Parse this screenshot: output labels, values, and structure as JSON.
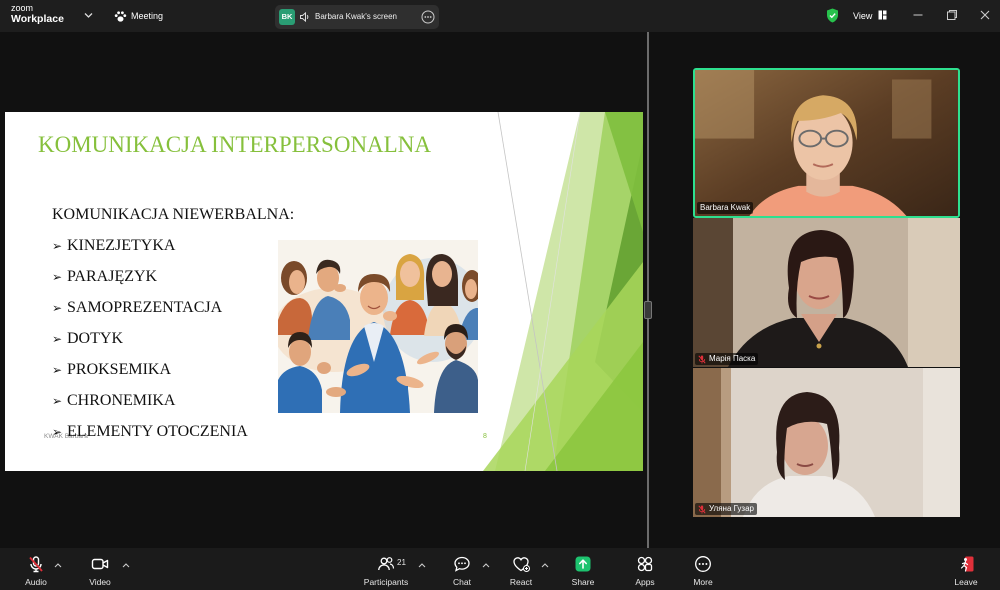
{
  "app": {
    "logo_top": "zoom",
    "logo_bottom": "Workplace",
    "meeting_label": "Meeting"
  },
  "share_pill": {
    "avatar_initials": "BK",
    "label": "Barbara Kwak's screen"
  },
  "window_controls": {
    "view_label": "View"
  },
  "slide": {
    "title": "KOMUNIKACJA INTERPERSONALNA",
    "subtitle": "KOMUNIKACJA NIEWERBALNA:",
    "bullet_glyph": "➢",
    "items": [
      "KINEZJETYKA",
      "PARAJĘZYK",
      "SAMOPREZENTACJA",
      "DOTYK",
      "PROKSEMIKA",
      "CHRONEMIKA",
      "ELEMENTY OTOCZENIA"
    ],
    "footer": "KWAK Barbara",
    "page_number": "8"
  },
  "video_tiles": [
    {
      "name": "Barbara Kwak",
      "muted": false,
      "active_speaker": true
    },
    {
      "name": "Марія Паска",
      "muted": true,
      "active_speaker": false
    },
    {
      "name": "Уляна Гузар",
      "muted": true,
      "active_speaker": false
    }
  ],
  "toolbar": {
    "audio": {
      "label": "Audio",
      "muted": true
    },
    "video": {
      "label": "Video"
    },
    "participants": {
      "label": "Participants",
      "count": "21"
    },
    "chat": {
      "label": "Chat"
    },
    "react": {
      "label": "React"
    },
    "share": {
      "label": "Share"
    },
    "apps": {
      "label": "Apps"
    },
    "more": {
      "label": "More"
    },
    "leave": {
      "label": "Leave"
    }
  },
  "icons": {
    "audio": "mic-muted-icon",
    "video": "video-camera-icon",
    "participants": "participants-icon",
    "chat": "chat-bubble-icon",
    "react": "heart-icon",
    "share": "share-screen-icon",
    "apps": "apps-icon",
    "more": "more-icon",
    "leave": "leave-door-icon",
    "security": "shield-check-icon"
  },
  "colors": {
    "active_speaker_border": "#2ee08f",
    "share_button": "#1dc36f",
    "leave_button": "#e0303a",
    "muted_mic": "#e0303a",
    "security_shield": "#27c24c",
    "slide_title": "#86c03c",
    "presenter_avatar": "#2a9d74"
  }
}
